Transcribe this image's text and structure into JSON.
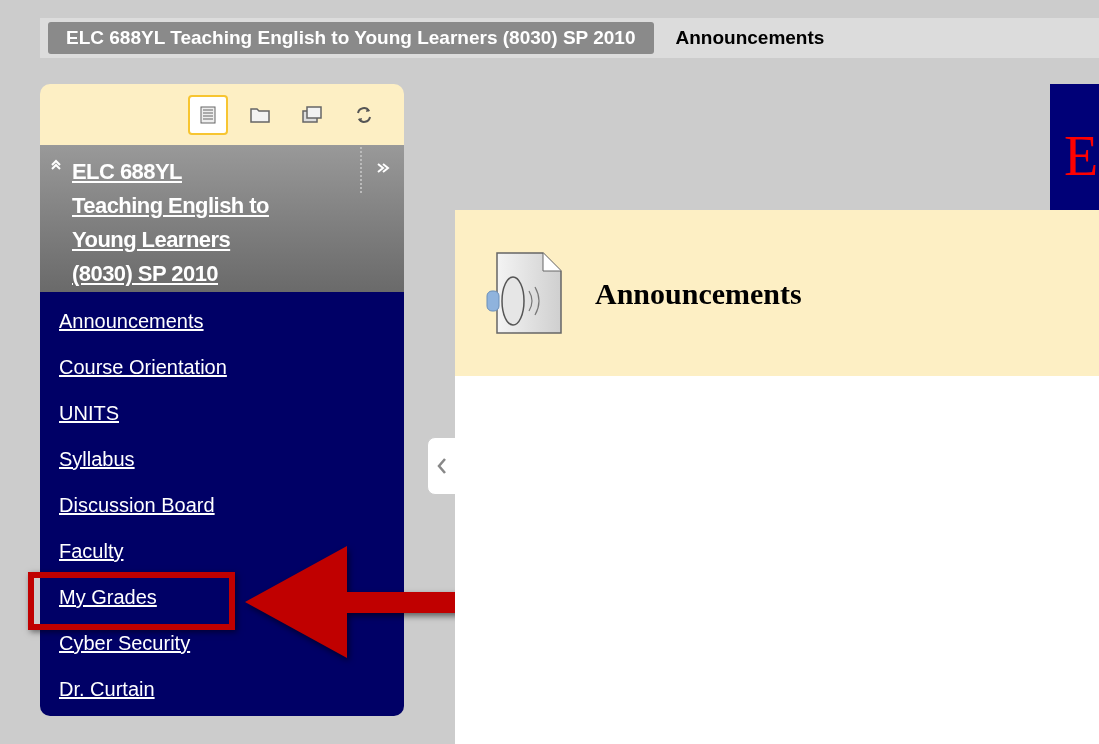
{
  "breadcrumbs": [
    {
      "label": "ELC 688YL Teaching English to Young Learners (8030) SP 2010",
      "kind": "course"
    },
    {
      "label": "Announcements",
      "kind": "page"
    }
  ],
  "sidebar": {
    "toolbar": [
      {
        "kind": "list",
        "selected": true
      },
      {
        "kind": "folder",
        "selected": false
      },
      {
        "kind": "windows",
        "selected": false
      },
      {
        "kind": "refresh",
        "selected": false
      }
    ],
    "course_title": "ELC 688YL Teaching English to Young Learners (8030) SP 2010",
    "items": [
      {
        "label": "Announcements",
        "highlighted": false
      },
      {
        "label": "Course Orientation",
        "highlighted": false
      },
      {
        "label": "UNITS",
        "highlighted": false
      },
      {
        "label": "Syllabus",
        "highlighted": false
      },
      {
        "label": "Discussion Board",
        "highlighted": false
      },
      {
        "label": "Faculty",
        "highlighted": false
      },
      {
        "label": "My Grades",
        "highlighted": true
      },
      {
        "label": "Cyber Security",
        "highlighted": false
      },
      {
        "label": "Dr. Curtain",
        "highlighted": false
      }
    ]
  },
  "banner": {
    "text": "E"
  },
  "content": {
    "title": "Announcements"
  }
}
